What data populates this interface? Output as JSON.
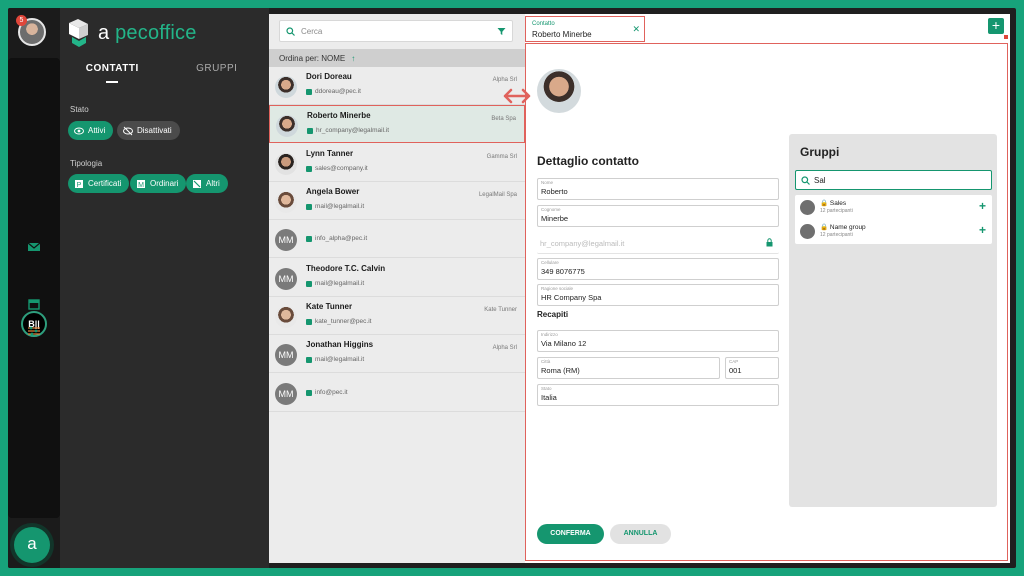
{
  "rail": {
    "notification_count": "5",
    "active_label": "B||",
    "logo_letter": "a"
  },
  "brand": {
    "prefix": "a",
    "name": "pecoffice"
  },
  "sidebar": {
    "tabs": [
      "CONTATTI",
      "GRUPPI"
    ],
    "stato_label": "Stato",
    "stato_chips": [
      "Attivi",
      "Disattivati"
    ],
    "tipologia_label": "Tipologia",
    "tipologia_chips": [
      "Certificati",
      "Ordinari",
      "Altri"
    ]
  },
  "list": {
    "search_placeholder": "Cerca",
    "sort_label": "Ordina per: NOME",
    "sort_arrow": "↑",
    "rows": [
      {
        "name": "Dori Doreau",
        "email": "ddoreau@pec.it",
        "company": "Alpha Srl",
        "avatar": "photo"
      },
      {
        "name": "Roberto Minerbe",
        "email": "hr_company@legalmail.it",
        "company": "Beta Spa",
        "avatar": "photo"
      },
      {
        "name": "Lynn Tanner",
        "email": "sales@company.it",
        "company": "Gamma Srl",
        "avatar": "photo"
      },
      {
        "name": "Angela Bower",
        "email": "mail@legalmail.it",
        "company": "LegalMail Spa",
        "avatar": "photo"
      },
      {
        "name": "",
        "email": "info_alpha@pec.it",
        "company": "",
        "avatar": "MM"
      },
      {
        "name": "Theodore T.C. Calvin",
        "email": "mail@legalmail.it",
        "company": "",
        "avatar": "MM"
      },
      {
        "name": "Kate Tunner",
        "email": "kate_tunner@pec.it",
        "company": "Kate Tunner",
        "avatar": "photo"
      },
      {
        "name": "Jonathan Higgins",
        "email": "mail@legalmail.it",
        "company": "Alpha Srl",
        "avatar": "MM"
      },
      {
        "name": "",
        "email": "info@pec.it",
        "company": "",
        "avatar": "MM"
      }
    ]
  },
  "detail": {
    "tab_caption": "Contatto",
    "tab_title": "Roberto Minerbe",
    "add_symbol": "+",
    "heading": "Dettaglio contatto",
    "fields": {
      "nome": {
        "label": "Nome",
        "value": "Roberto"
      },
      "cognome": {
        "label": "Cognome",
        "value": "Minerbe"
      },
      "email": {
        "placeholder": "hr_company@legalmail.it"
      },
      "cellulare": {
        "label": "Cellulare",
        "value": "349 8076775"
      },
      "ragione": {
        "label": "Ragione sociale",
        "value": "HR Company Spa"
      }
    },
    "recapiti_heading": "Recapiti",
    "recapiti": {
      "indirizzo": {
        "label": "Indirizzo",
        "value": "Via Milano 12"
      },
      "citta": {
        "label": "Città",
        "value": "Roma (RM)"
      },
      "cap": {
        "label": "CAP",
        "value": "001"
      },
      "stato": {
        "label": "Stato",
        "value": "Italia"
      }
    },
    "confirm_label": "CONFERMA",
    "cancel_label": "ANNULLA"
  },
  "groups": {
    "heading": "Gruppi",
    "search_value": "Sal",
    "items": [
      {
        "name": "Sales",
        "sub": "12 partecipanti"
      },
      {
        "name": "Name group",
        "sub": "12 partecipanti"
      }
    ]
  },
  "colors": {
    "accent": "#15966f",
    "highlight": "#e0625c"
  }
}
